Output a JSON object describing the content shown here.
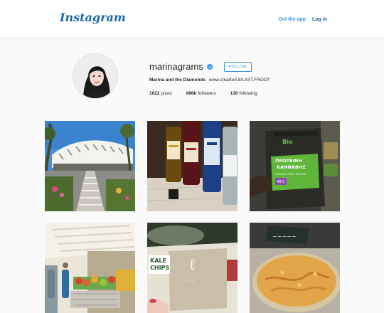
{
  "header": {
    "logo_text": "Instagram",
    "get_app_label": "Get the app",
    "login_label": "Log in"
  },
  "profile": {
    "username": "marinagrams",
    "follow_label": "FOLLOW",
    "full_name": "Marina and the Diamonds",
    "link": "www.smarturl.it/LAST.FROOT",
    "posts": "1022",
    "posts_label": "posts",
    "followers": "896k",
    "followers_label": "followers",
    "following": "130",
    "following_label": "following"
  },
  "posts": [
    {
      "icon": "modern-building-photo"
    },
    {
      "icon": "bottles-photo"
    },
    {
      "icon": "hemp-protein-bag-photo",
      "brand": "Bio",
      "title_line1": "ΠΡΩΤΕΙΝΗ",
      "title_line2": "ΚΑΝΝΑΒΗΣ",
      "subtitle": "ORGANIC HEMP PROTEIN",
      "badge": "48%"
    },
    {
      "icon": "market-produce-photo"
    },
    {
      "icon": "kale-chips-photo",
      "text_line1": "KALE",
      "text_line2": "CHIPS"
    },
    {
      "icon": "pie-photo"
    }
  ],
  "colors": {
    "link_blue": "#3897f0",
    "logo_blue": "#1b6aa5"
  }
}
